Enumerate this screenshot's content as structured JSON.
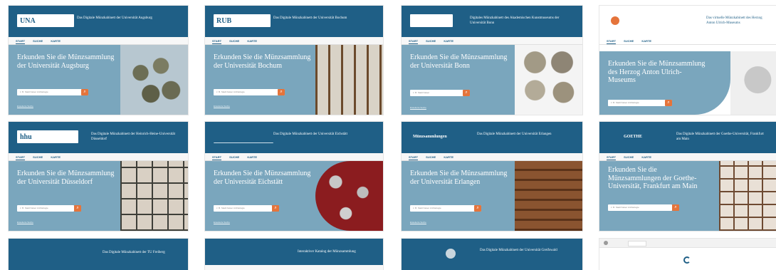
{
  "cards": [
    {
      "id": "augsburg",
      "logo": "UNA",
      "site_title": "Das Digitale Münzkabinett der Universität Augsburg",
      "nav": [
        "START",
        "SUCHE",
        "KARTE"
      ],
      "hero_title": "Erkunden Sie die Münzsammlung der Universität Augsburg",
      "search_placeholder": "z. B. Stadt Kaiser Archäologie",
      "adv_link": "Erweiterte Suche"
    },
    {
      "id": "bochum",
      "logo": "RUB",
      "site_title": "Das Digitale Münzkabinett der Universität Bochum",
      "nav": [
        "START",
        "SUCHE",
        "KARTE"
      ],
      "hero_title": "Erkunden Sie die Münzsammlung der Universität Bochum",
      "search_placeholder": "z. B. Stadt Kaiser Archäologie",
      "adv_link": "Erweiterte Suche"
    },
    {
      "id": "bonn",
      "logo": "",
      "site_title": "Digitales Münzkabinett des Akademischen Kunstmuseums der Universität Bonn",
      "nav": [
        "START",
        "SUCHE",
        "KARTE"
      ],
      "hero_title": "Erkunden Sie die Münzsammlung der Universität Bonn",
      "search_placeholder": "z. B. Stadt Kaiser",
      "adv_link": "Erweiterte Suche"
    },
    {
      "id": "gotha",
      "logo": "",
      "site_title": "Das virtuelle Münzkabinett des Herzog Anton Ulrich-Museums",
      "nav": [
        "START",
        "SUCHE",
        "KARTE"
      ],
      "hero_title": "Erkunden Sie die Münzsammlung des Herzog Anton Ulrich-Museums",
      "search_placeholder": "z. B. Stadt Kaiser Archäologie",
      "adv_link": ""
    },
    {
      "id": "duesseldorf",
      "logo": "hhu",
      "site_title": "Das Digitale Münzkabinett der Heinrich-Heine-Universität Düsseldorf",
      "nav": [
        "START",
        "SUCHE",
        "KARTE"
      ],
      "hero_title": "Erkunden Sie die Münzsammlung der Universität Düsseldorf",
      "search_placeholder": "z. B. Stadt Kaiser Archäologie",
      "adv_link": "Erweiterte Suche"
    },
    {
      "id": "eichstaett",
      "logo": "",
      "site_title": "Das Digitale Münzkabinett der Universität Eichstätt",
      "nav": [
        "START",
        "SUCHE",
        "KARTE"
      ],
      "hero_title": "Erkunden Sie die Münzsammlung der Universität Eichstätt",
      "search_placeholder": "z. B. Stadt Kaiser Archäologie",
      "adv_link": "Erweiterte Suche"
    },
    {
      "id": "erlangen",
      "logo": "Münzsammlungen",
      "site_title": "Das Digitale Münzkabinett der Universität Erlangen",
      "nav": [
        "START",
        "SUCHE",
        "KARTE"
      ],
      "hero_title": "Erkunden Sie die Münzsammlung der Universität Erlangen",
      "search_placeholder": "z. B. Stadt Kaiser Archäologie",
      "adv_link": "Erweiterte Suche"
    },
    {
      "id": "frankfurt",
      "logo": "GOETHE",
      "site_title": "Das Digitale Münzkabinett der Goethe-Universität, Frankfurt am Main",
      "nav": [
        "START",
        "SUCHE",
        "KARTE"
      ],
      "hero_title": "Erkunden Sie die Münzsammlungen der Goethe-Universität, Frankfurt am Main",
      "search_placeholder": "z. B. Stadt Kaiser Archäologie",
      "adv_link": ""
    },
    {
      "id": "freiberg",
      "logo": "",
      "site_title": "Das Digitale Münzkabinett der TU Freiberg"
    },
    {
      "id": "interactive",
      "logo": "",
      "site_title": "Interaktiver Katalog der Münzsammlung"
    },
    {
      "id": "greifswald",
      "logo": "",
      "site_title": "Das Digitale Münzkabinett der Universität Greifswald"
    },
    {
      "id": "gottingen",
      "logo": "",
      "site_title": ""
    }
  ]
}
